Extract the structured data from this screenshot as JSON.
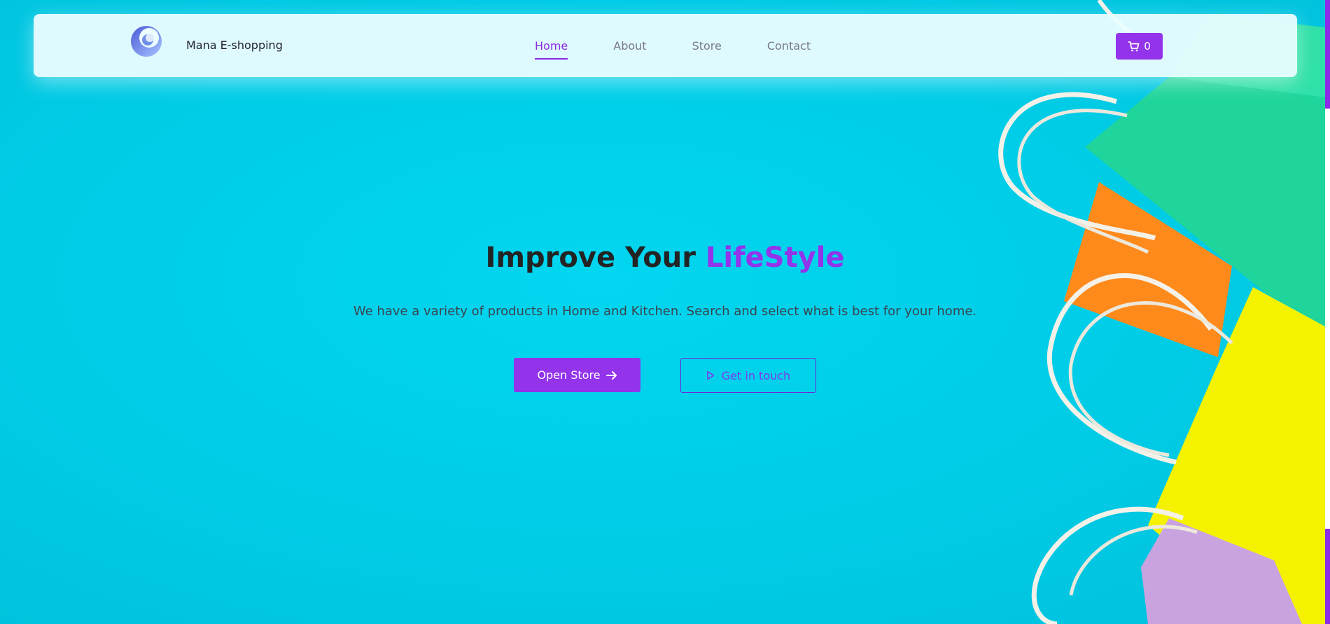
{
  "brand": {
    "name": "Mana E-shopping",
    "logo_icon": "crescent-logo-icon"
  },
  "nav": {
    "items": [
      {
        "label": "Home",
        "active": true
      },
      {
        "label": "About",
        "active": false
      },
      {
        "label": "Store",
        "active": false
      },
      {
        "label": "Contact",
        "active": false
      }
    ]
  },
  "cart": {
    "count": "0",
    "icon": "cart-icon"
  },
  "hero": {
    "title_main": "Improve Your ",
    "title_accent": "LifeStyle",
    "subtitle": "We have a variety of products in Home and Kitchen. Search and select what is best for your home.",
    "primary_button": "Open Store",
    "primary_icon": "arrow-right-icon",
    "secondary_button": "Get in touch",
    "secondary_icon": "play-icon"
  },
  "colors": {
    "accent": "#9333ea",
    "background": "#00cbe6",
    "navbar": "#ecfdff"
  }
}
